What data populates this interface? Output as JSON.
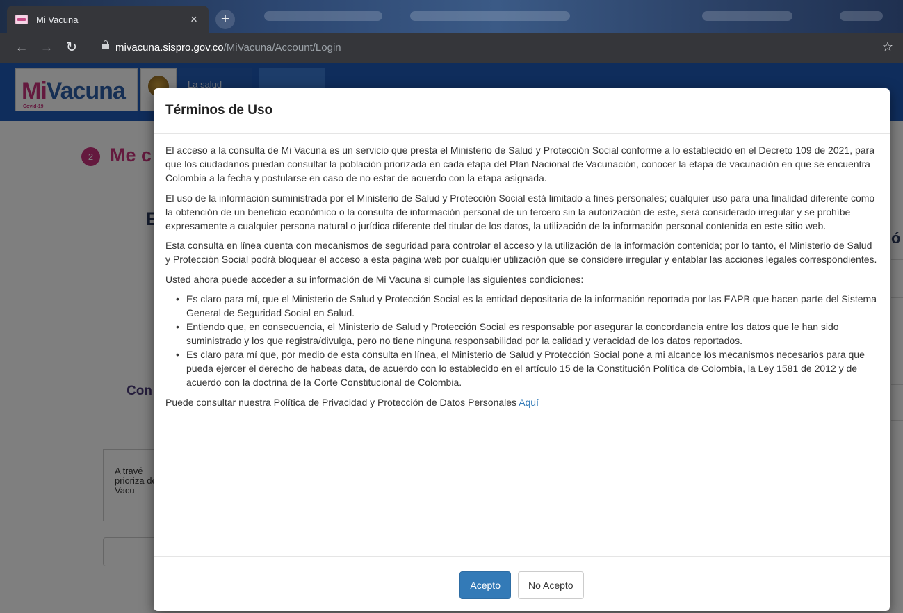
{
  "browser": {
    "tab_title": "Mi Vacuna",
    "tab_close": "×",
    "new_tab": "+",
    "url_host": "mivacuna.sispro.gov.co",
    "url_path": "/MiVacuna/Account/Login"
  },
  "site": {
    "logo_mi": "Mi",
    "logo_vacuna": "Vacuna",
    "logo_sub": "Covid-19",
    "nav_item": "La salud",
    "step_number": "2",
    "step_title_fragment": "Me c",
    "fragment_b": "E",
    "fragment_right": "ó",
    "fragment_con": "Con",
    "card_text": "A travé prioriza de Vacu"
  },
  "modal": {
    "title": "Términos de Uso",
    "paragraphs": [
      "El acceso a la consulta de Mi Vacuna es un servicio que presta el Ministerio de Salud y Protección Social conforme a lo establecido en el Decreto 109 de 2021, para que los ciudadanos puedan consultar la población priorizada en cada etapa del Plan Nacional de Vacunación, conocer la etapa de vacunación en que se encuentra Colombia a la fecha y postularse en caso de no estar de acuerdo con la etapa asignada.",
      "El uso de la información suministrada por el Ministerio de Salud y Protección Social está limitado a fines personales; cualquier uso para una finalidad diferente como la obtención de un beneficio económico o la consulta de información personal de un tercero sin la autorización de este, será considerado irregular y se prohíbe expresamente a cualquier persona natural o jurídica diferente del titular de los datos, la utilización de la información personal contenida en este sitio web.",
      "Esta consulta en línea cuenta con mecanismos de seguridad para controlar el acceso y la utilización de la información contenida; por lo tanto, el Ministerio de Salud y Protección Social podrá bloquear el acceso a esta página web por cualquier utilización que se considere irregular y entablar las acciones legales correspondientes.",
      "Usted ahora puede acceder a su información de Mi Vacuna si cumple las siguientes condiciones:"
    ],
    "conditions": [
      "Es claro para mí, que el Ministerio de Salud y Protección Social es la entidad depositaria de la información reportada por las EAPB que hacen parte del Sistema General de Seguridad Social en Salud.",
      "Entiendo que, en consecuencia, el Ministerio de Salud y Protección Social es responsable por asegurar la concordancia entre los datos que le han sido suministrado y los que registra/divulga, pero no tiene ninguna responsabilidad por la calidad y veracidad de los datos reportados.",
      "Es claro para mí que, por medio de esta consulta en línea, el Ministerio de Salud y Protección Social pone a mi alcance los mecanismos necesarios para que pueda ejercer el derecho de habeas data, de acuerdo con lo establecido en el artículo 15 de la Constitución Política de Colombia, la Ley 1581 de 2012 y de acuerdo con la doctrina de la Corte Constitucional de Colombia."
    ],
    "privacy_text": "Puede consultar nuestra Política de Privacidad y Protección de Datos Personales ",
    "privacy_link": "Aquí",
    "accept_label": "Acepto",
    "reject_label": "No Acepto"
  },
  "colors": {
    "primary_button": "#337ab7",
    "brand_magenta": "#c8327c",
    "header_blue": "#1e5bb8"
  }
}
